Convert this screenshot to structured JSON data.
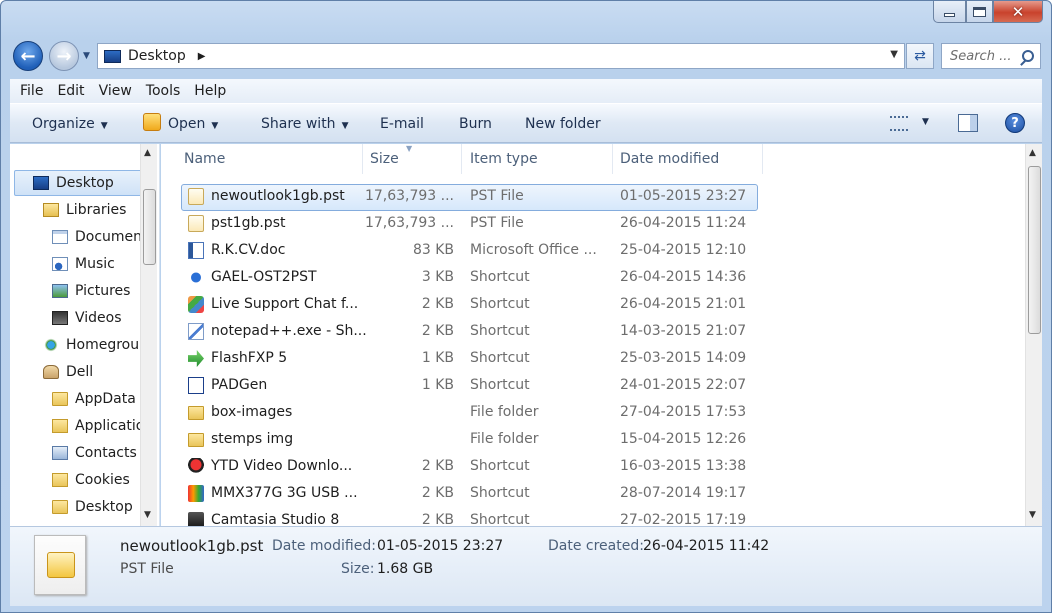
{
  "window": {
    "caption": {
      "minimize": "—",
      "maximize": "",
      "close": "✕"
    }
  },
  "nav": {
    "back_glyph": "←",
    "forward_glyph": "→",
    "address": "Desktop",
    "address_arrow": "▶",
    "refresh_glyph": "⇄",
    "search_placeholder": "Search ..."
  },
  "menubar": {
    "items": [
      "File",
      "Edit",
      "View",
      "Tools",
      "Help"
    ]
  },
  "commandbar": {
    "organize": "Organize",
    "open": "Open",
    "share_with": "Share with",
    "email": "E-mail",
    "burn": "Burn",
    "new_folder": "New folder",
    "help_glyph": "?"
  },
  "navpane": {
    "items": [
      {
        "label": "Desktop",
        "icon": "desktop-icon"
      },
      {
        "label": "Libraries",
        "icon": "libraries-icon"
      },
      {
        "label": "Documents",
        "icon": "documents-icon"
      },
      {
        "label": "Music",
        "icon": "music-icon"
      },
      {
        "label": "Pictures",
        "icon": "pictures-icon"
      },
      {
        "label": "Videos",
        "icon": "videos-icon"
      },
      {
        "label": "Homegroup",
        "icon": "homegroup-icon"
      },
      {
        "label": "Dell",
        "icon": "user-icon"
      },
      {
        "label": "AppData",
        "icon": "folder-icon"
      },
      {
        "label": "Application Data",
        "icon": "shortcut-folder-icon"
      },
      {
        "label": "Contacts",
        "icon": "contacts-icon"
      },
      {
        "label": "Cookies",
        "icon": "shortcut-folder-icon"
      },
      {
        "label": "Desktop",
        "icon": "folder-icon"
      }
    ]
  },
  "filelist": {
    "columns": {
      "name": "Name",
      "size": "Size",
      "type": "Item type",
      "date": "Date modified"
    },
    "rows": [
      {
        "name": "newoutlook1gb.pst",
        "size": "17,63,793 ...",
        "type": "PST File",
        "date": "01-05-2015 23:27",
        "icon": "pst-file-icon"
      },
      {
        "name": "pst1gb.pst",
        "size": "17,63,793 ...",
        "type": "PST File",
        "date": "26-04-2015 11:24",
        "icon": "pst-file-icon"
      },
      {
        "name": "R.K.CV.doc",
        "size": "83 KB",
        "type": "Microsoft Office ...",
        "date": "25-04-2015 12:10",
        "icon": "word-doc-icon"
      },
      {
        "name": "GAEL-OST2PST",
        "size": "3 KB",
        "type": "Shortcut",
        "date": "26-04-2015 14:36",
        "icon": "gael-shortcut-icon"
      },
      {
        "name": "Live Support Chat f...",
        "size": "2 KB",
        "type": "Shortcut",
        "date": "26-04-2015 21:01",
        "icon": "chat-shortcut-icon"
      },
      {
        "name": "notepad++.exe - Sh...",
        "size": "2 KB",
        "type": "Shortcut",
        "date": "14-03-2015 21:07",
        "icon": "notepad-shortcut-icon"
      },
      {
        "name": "FlashFXP 5",
        "size": "1 KB",
        "type": "Shortcut",
        "date": "25-03-2015 14:09",
        "icon": "flashfxp-shortcut-icon"
      },
      {
        "name": "PADGen",
        "size": "1 KB",
        "type": "Shortcut",
        "date": "24-01-2015 22:07",
        "icon": "padgen-shortcut-icon"
      },
      {
        "name": "box-images",
        "size": "",
        "type": "File folder",
        "date": "27-04-2015 17:53",
        "icon": "folder-icon"
      },
      {
        "name": "stemps img",
        "size": "",
        "type": "File folder",
        "date": "15-04-2015 12:26",
        "icon": "folder-icon"
      },
      {
        "name": "YTD Video Downlo...",
        "size": "2 KB",
        "type": "Shortcut",
        "date": "16-03-2015 13:38",
        "icon": "ytd-shortcut-icon"
      },
      {
        "name": "MMX377G 3G USB ...",
        "size": "2 KB",
        "type": "Shortcut",
        "date": "28-07-2014 19:17",
        "icon": "modem-shortcut-icon"
      },
      {
        "name": "Camtasia Studio 8",
        "size": "2 KB",
        "type": "Shortcut",
        "date": "27-02-2015 17:19",
        "icon": "camtasia-shortcut-icon"
      }
    ]
  },
  "details": {
    "name": "newoutlook1gb.pst",
    "type": "PST File",
    "date_modified_label": "Date modified:",
    "date_modified": "01-05-2015 23:27",
    "date_created_label": "Date created:",
    "date_created": "26-04-2015 11:42",
    "size_label": "Size:",
    "size": "1.68 GB"
  }
}
